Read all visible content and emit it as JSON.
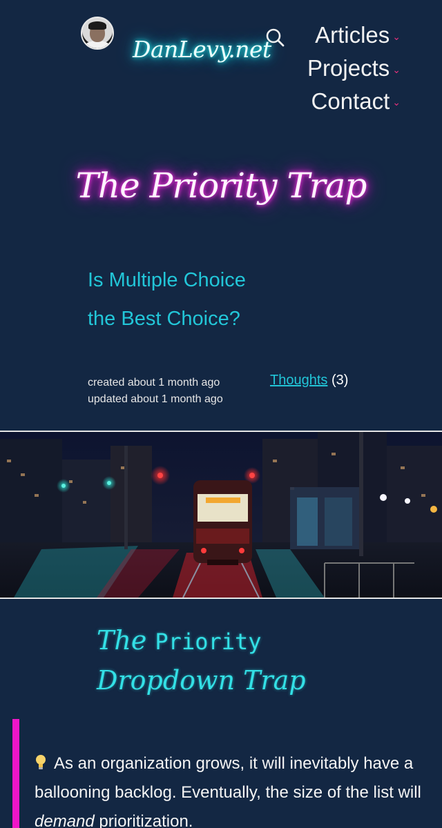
{
  "header": {
    "site_title": "DanLevy.net",
    "nav": [
      {
        "label": "Articles"
      },
      {
        "label": "Projects"
      },
      {
        "label": "Contact"
      }
    ]
  },
  "post": {
    "title": "The Priority Trap",
    "subtitle_line1": "Is Multiple Choice",
    "subtitle_line2": "the Best Choice?",
    "created": "created about 1 month ago",
    "updated": "updated about 1 month ago",
    "tag_label": "Thoughts",
    "tag_count": "(3)"
  },
  "section": {
    "heading_part1": "The",
    "heading_part2": "Priority",
    "heading_part3": "Dropdown Trap"
  },
  "callout": {
    "text_before": "As an organization grows, it will inevitably have a ballooning backlog. Eventually, the size of the list will",
    "emphasis": "demand",
    "text_after": "prioritization."
  },
  "colors": {
    "background": "#132743",
    "neon_cyan": "#22c6d8",
    "neon_pink": "#f016c8",
    "chevron_accent": "#e8317c"
  },
  "icons": {
    "search": "search-icon",
    "chevron": "chevron-down-icon",
    "bulb": "light-bulb-icon"
  }
}
